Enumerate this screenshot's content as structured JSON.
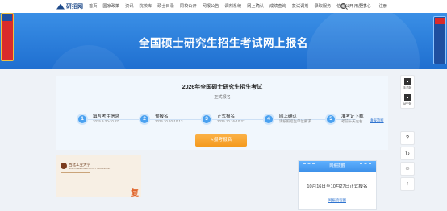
{
  "brand": {
    "name": "研招网"
  },
  "nav": {
    "items": [
      "首页",
      "国家政策",
      "资讯",
      "院校库",
      "硕士目录",
      "同校公开",
      "网报公告",
      "调剂系统",
      "网上确认",
      "成绩查询",
      "复试调剂",
      "录取服务",
      "信息公开"
    ],
    "more": "更多",
    "user_center": "用户中心",
    "logout": "注册"
  },
  "banner": {
    "title": "全国硕士研究生招生考试网上报名"
  },
  "exam": {
    "title": "2026年全国硕士研究生招生考试",
    "subtitle": "正式报名"
  },
  "steps": [
    {
      "num": "1",
      "name": "填写考生信息",
      "date": "2025.9.30-10.27"
    },
    {
      "num": "2",
      "name": "预报名",
      "date": "2025.10.10-10.13"
    },
    {
      "num": "3",
      "name": "正式报名",
      "date": "2025.10.16-10.27"
    },
    {
      "num": "4",
      "name": "网上确认",
      "date": "请按照招生单位要求"
    },
    {
      "num": "5",
      "name": "准考证下载",
      "date": "考前十天左右"
    }
  ],
  "flow_link": "填报流程",
  "apply_button": "报考报名",
  "rail": {
    "item1": "手机版",
    "item2": "APP版"
  },
  "thumb": {
    "school": "西北工业大学",
    "sub": "NORTHWESTERN POLYTECHNICAL",
    "big": "复"
  },
  "notice": {
    "header": "网报提醒",
    "text": "10月16日至10月27日正式报名",
    "link": "网报流程图"
  },
  "colors": {
    "primary": "#2f74d0",
    "accent": "#f49a1e",
    "banner": "#3a8fe6"
  }
}
